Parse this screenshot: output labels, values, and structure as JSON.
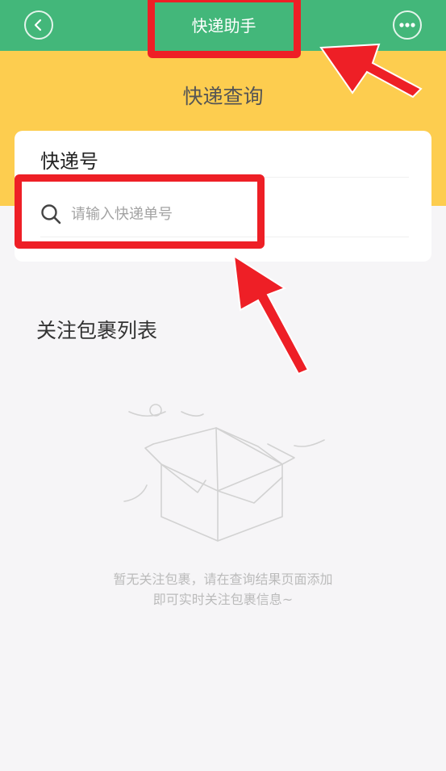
{
  "header": {
    "title": "快递助手",
    "back_icon": "chevron-left-icon",
    "more_icon": "more-dots-icon"
  },
  "page": {
    "heading": "快递查询"
  },
  "query_card": {
    "label": "快递号",
    "search_placeholder": "请输入快递单号",
    "search_value": ""
  },
  "followed": {
    "title": "关注包裹列表",
    "empty_line1": "暂无关注包裹，请在查询结果页面添加",
    "empty_line2": "即可实时关注包裹信息~"
  },
  "colors": {
    "topbar": "#43b77a",
    "banner": "#fdcd4f",
    "annotation": "#ee1f26"
  }
}
